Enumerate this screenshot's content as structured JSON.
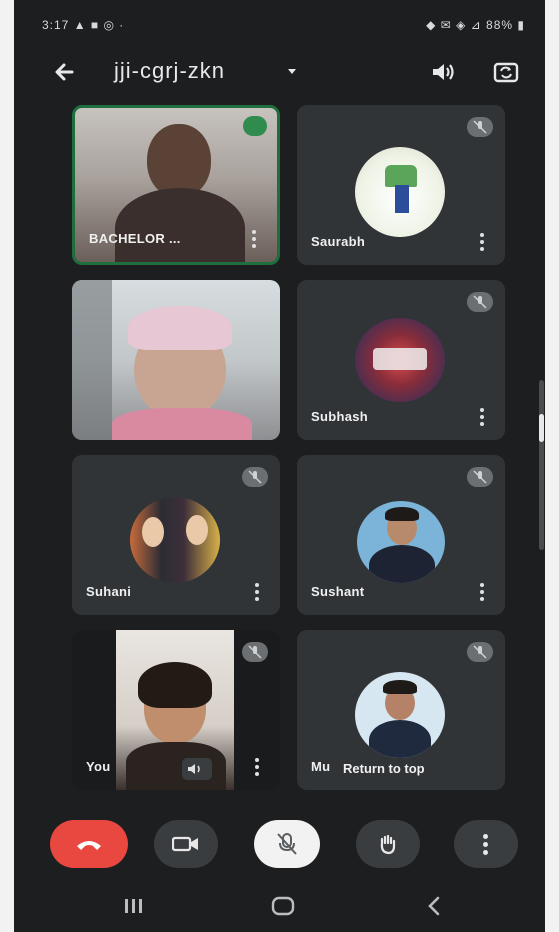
{
  "status_bar": {
    "time": "3:17 ▲ ■ ◎ ·",
    "right_indicators": "◆ ✉ ◈ ⊿ 88% ▮"
  },
  "app_bar": {
    "title": "jji-cgrj-zkn",
    "icons": [
      "back-arrow-icon",
      "speaker-icon",
      "flip-camera-icon"
    ]
  },
  "tiles": [
    {
      "name": "BACHELOR ...",
      "type": "video"
    },
    {
      "name": "Saurabh",
      "type": "avatar",
      "muted": true
    },
    {
      "name": "",
      "type": "video"
    },
    {
      "name": "Subhash",
      "type": "avatar",
      "muted": true
    },
    {
      "name": "Suhani",
      "type": "avatar",
      "muted": true
    },
    {
      "name": "Sushant",
      "type": "avatar",
      "muted": true
    },
    {
      "name": "You",
      "type": "video",
      "muted": true
    },
    {
      "name": "Mu",
      "type": "avatar",
      "muted": true
    }
  ],
  "overlay": {
    "return_to_top": "Return to top"
  },
  "controls": {
    "end_call": "end-call-icon",
    "camera": "video-camera-icon",
    "mic": "mic-off-icon",
    "hand": "raise-hand-icon",
    "more": "more-vert-icon",
    "colors": {
      "end_call": "#e8483f",
      "mic_bg": "#f2f2f2",
      "dark_btn": "#3a3d40"
    }
  },
  "nav_bar": {
    "icons": [
      "recent-apps-icon",
      "home-icon",
      "back-icon"
    ]
  }
}
